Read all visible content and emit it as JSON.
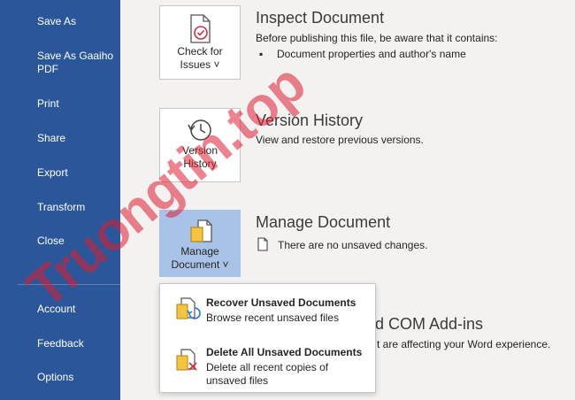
{
  "sidebar": {
    "items": [
      {
        "label": "Save As"
      },
      {
        "label": "Save As Gaaiho"
      },
      {
        "label": "PDF"
      },
      {
        "label": "Print"
      },
      {
        "label": "Share"
      },
      {
        "label": "Export"
      },
      {
        "label": "Transform"
      },
      {
        "label": "Close"
      },
      {
        "label": "Account"
      },
      {
        "label": "Feedback"
      },
      {
        "label": "Options"
      }
    ]
  },
  "inspect": {
    "button_line1": "Check for",
    "button_line2": "Issues ˅",
    "title": "Inspect Document",
    "desc": "Before publishing this file, be aware that it contains:",
    "bullet": "Document properties and author's name"
  },
  "version": {
    "button_line1": "Version",
    "button_line2": "History",
    "title": "Version History",
    "desc": "View and restore previous versions."
  },
  "manage": {
    "button_line1": "Manage",
    "button_line2": "Document ˅",
    "title": "Manage Document",
    "desc": "There are no unsaved changes."
  },
  "com": {
    "title_partial": "d COM Add-ins",
    "desc_partial": "t are affecting your Word experience."
  },
  "dropdown": {
    "recover_title": "Recover Unsaved Documents",
    "recover_desc": "Browse recent unsaved files",
    "delete_title": "Delete All Unsaved Documents",
    "delete_desc": "Delete all recent copies of unsaved files"
  },
  "watermark": "Truongtin.top",
  "colors": {
    "sidebar": "#2b579a",
    "accent": "#a9c2e8",
    "background": "#f3f2f1"
  }
}
